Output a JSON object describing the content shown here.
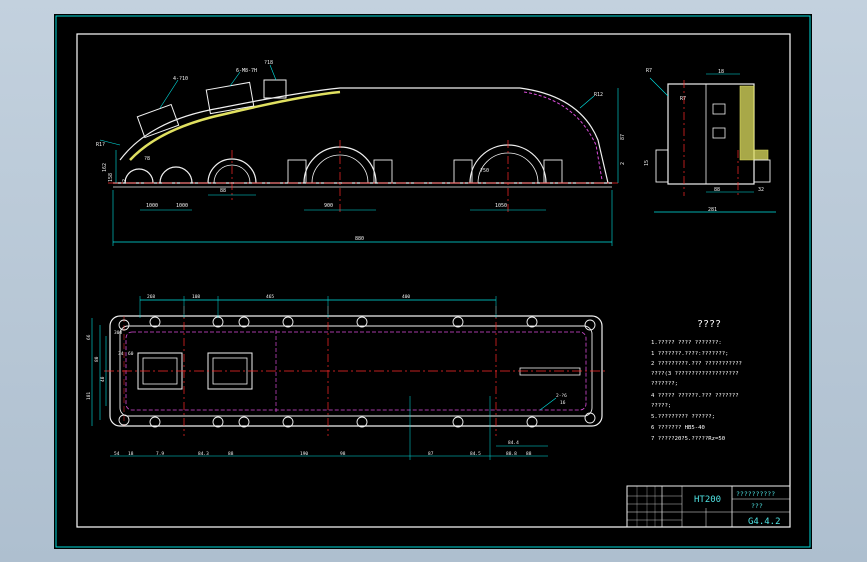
{
  "colors": {
    "background": "#000000",
    "frame": "#ffffff",
    "dimension": "#00e5e5",
    "centerline": "#ff2a2a",
    "hidden": "#d94cd9",
    "section_fill": "#e0e060",
    "outline": "#f0f0f0"
  },
  "tech_requirements": {
    "title": "????",
    "lines": [
      "1.????? ???? ???????:",
      "1 ???????.????:???????;",
      "2 ?????????.??? ???????????",
      "  ????(3 ???????????????????",
      "  ???????;",
      "4 ????? ??????.??? ???????",
      "  ?????;",
      "5.????????? ??????;",
      "6 ??????? HB5-40",
      "7 ?????20?5.?????Rz=50"
    ]
  },
  "title_block": {
    "material": "HT200",
    "part_name": "??????????",
    "scale_label": "???",
    "drawing_no": "G4.4.2"
  },
  "dimensions": {
    "side_view": {
      "overall_length": "880",
      "bore_1": "1000",
      "bore_2": "1000",
      "bore_3": "88",
      "bore_4": "900",
      "bore_5": "1050",
      "height_left": "162",
      "height_right_1": "87",
      "height_right_2": "2",
      "small_1": "158",
      "small_2": "2",
      "top_1": "4-?10",
      "top_2": "6-M8-7H",
      "top_3": "?18",
      "hole_1": "R1?",
      "hole_2": "?8",
      "hole_3": "?50",
      "hole_4": "R12"
    },
    "end_view": {
      "width_total": "281",
      "width_inner": "88",
      "height_1": "32",
      "height_2": "15",
      "thickness": "18",
      "corner": "R7",
      "top_label": "R7"
    },
    "plan_view": {
      "top_1": "268",
      "top_2": "108",
      "top_3": "465",
      "top_4": "400",
      "side_1": "66",
      "side_2": "80",
      "side_3": "40",
      "side_4": "181",
      "side_5": "300",
      "side_6": "34",
      "side_7": "60",
      "bottom": [
        "54",
        "18",
        "7.9",
        "84.3",
        "88",
        "190",
        "98",
        "87",
        "84.5",
        "88.8",
        "88",
        "84.4"
      ],
      "note_1": "2-?6",
      "note_2": "16"
    }
  }
}
